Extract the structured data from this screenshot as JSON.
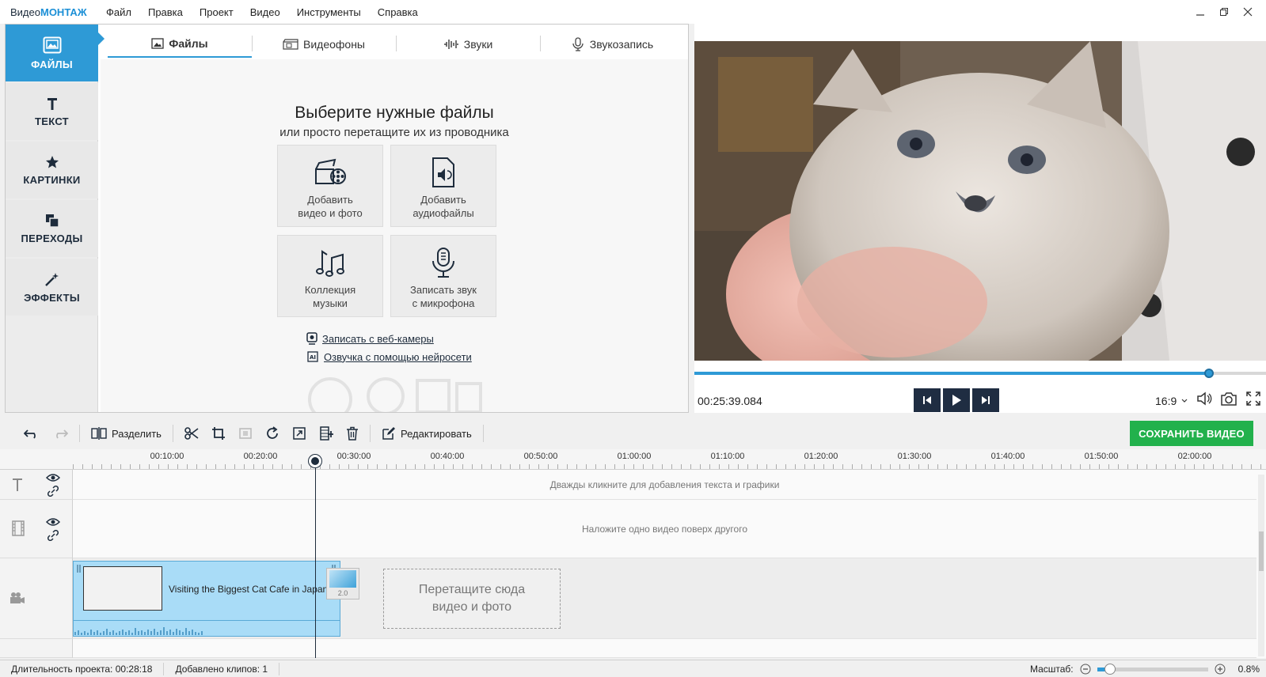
{
  "app": {
    "logo_part1": "Видео",
    "logo_part2": "МОНТАЖ"
  },
  "menu": [
    "Файл",
    "Правка",
    "Проект",
    "Видео",
    "Инструменты",
    "Справка"
  ],
  "sidebar": {
    "items": [
      {
        "label": "ФАЙЛЫ",
        "icon": "image-icon",
        "active": true
      },
      {
        "label": "ТЕКСТ",
        "icon": "text-icon",
        "active": false
      },
      {
        "label": "КАРТИНКИ",
        "icon": "star-icon",
        "active": false
      },
      {
        "label": "ПЕРЕХОДЫ",
        "icon": "transition-icon",
        "active": false
      },
      {
        "label": "ЭФФЕКТЫ",
        "icon": "magic-wand-icon",
        "active": false
      }
    ]
  },
  "tabs": [
    {
      "label": "Файлы",
      "icon": "image-icon",
      "active": true
    },
    {
      "label": "Видеофоны",
      "icon": "clapper-icon",
      "active": false
    },
    {
      "label": "Звуки",
      "icon": "waveform-icon",
      "active": false
    },
    {
      "label": "Звукозапись",
      "icon": "microphone-icon",
      "active": false
    }
  ],
  "files": {
    "title": "Выберите нужные файлы",
    "subtitle": "или просто перетащите их из проводника",
    "cards": [
      {
        "label": "Добавить\nвидео и фото",
        "icon": "film-reel-icon"
      },
      {
        "label": "Добавить\nаудиофайлы",
        "icon": "audio-file-icon"
      },
      {
        "label": "Коллекция\nмузыки",
        "icon": "music-notes-icon"
      },
      {
        "label": "Записать звук\nс микрофона",
        "icon": "microphone-icon"
      }
    ],
    "links": [
      {
        "label": "Записать с веб-камеры",
        "icon": "webcam-icon"
      },
      {
        "label": "Озвучка с помощью нейросети",
        "icon": "ai-chip-icon"
      }
    ]
  },
  "preview": {
    "timecode": "00:25:39.084",
    "progress": 0.9,
    "aspect": "16:9"
  },
  "toolbar": {
    "split_label": "Разделить",
    "edit_label": "Редактировать",
    "save_label": "СОХРАНИТЬ ВИДЕО"
  },
  "ruler": {
    "labels": [
      "00:10:00",
      "00:20:00",
      "00:30:00",
      "00:40:00",
      "00:50:00",
      "01:00:00",
      "01:10:00",
      "01:20:00",
      "01:30:00",
      "01:40:00",
      "01:50:00",
      "02:00:00"
    ]
  },
  "timeline": {
    "text_hint": "Дважды кликните для добавления текста и графики",
    "overlay_hint": "Наложите одно видео поверх другого",
    "clip_title": "Visiting the Biggest Cat Cafe in Japan",
    "transition_badge": "2.0",
    "drop_zone": "Перетащите сюда\nвидео и фото"
  },
  "status": {
    "duration_label": "Длительность проекта:",
    "duration_value": "00:28:18",
    "clips_label": "Добавлено клипов:",
    "clips_value": "1",
    "zoom_label": "Масштаб:",
    "zoom_value": "0.8%",
    "zoom_level": 0.12
  },
  "colors": {
    "accent": "#2e9ad6",
    "save": "#22b14c",
    "dark": "#1f2d42"
  }
}
